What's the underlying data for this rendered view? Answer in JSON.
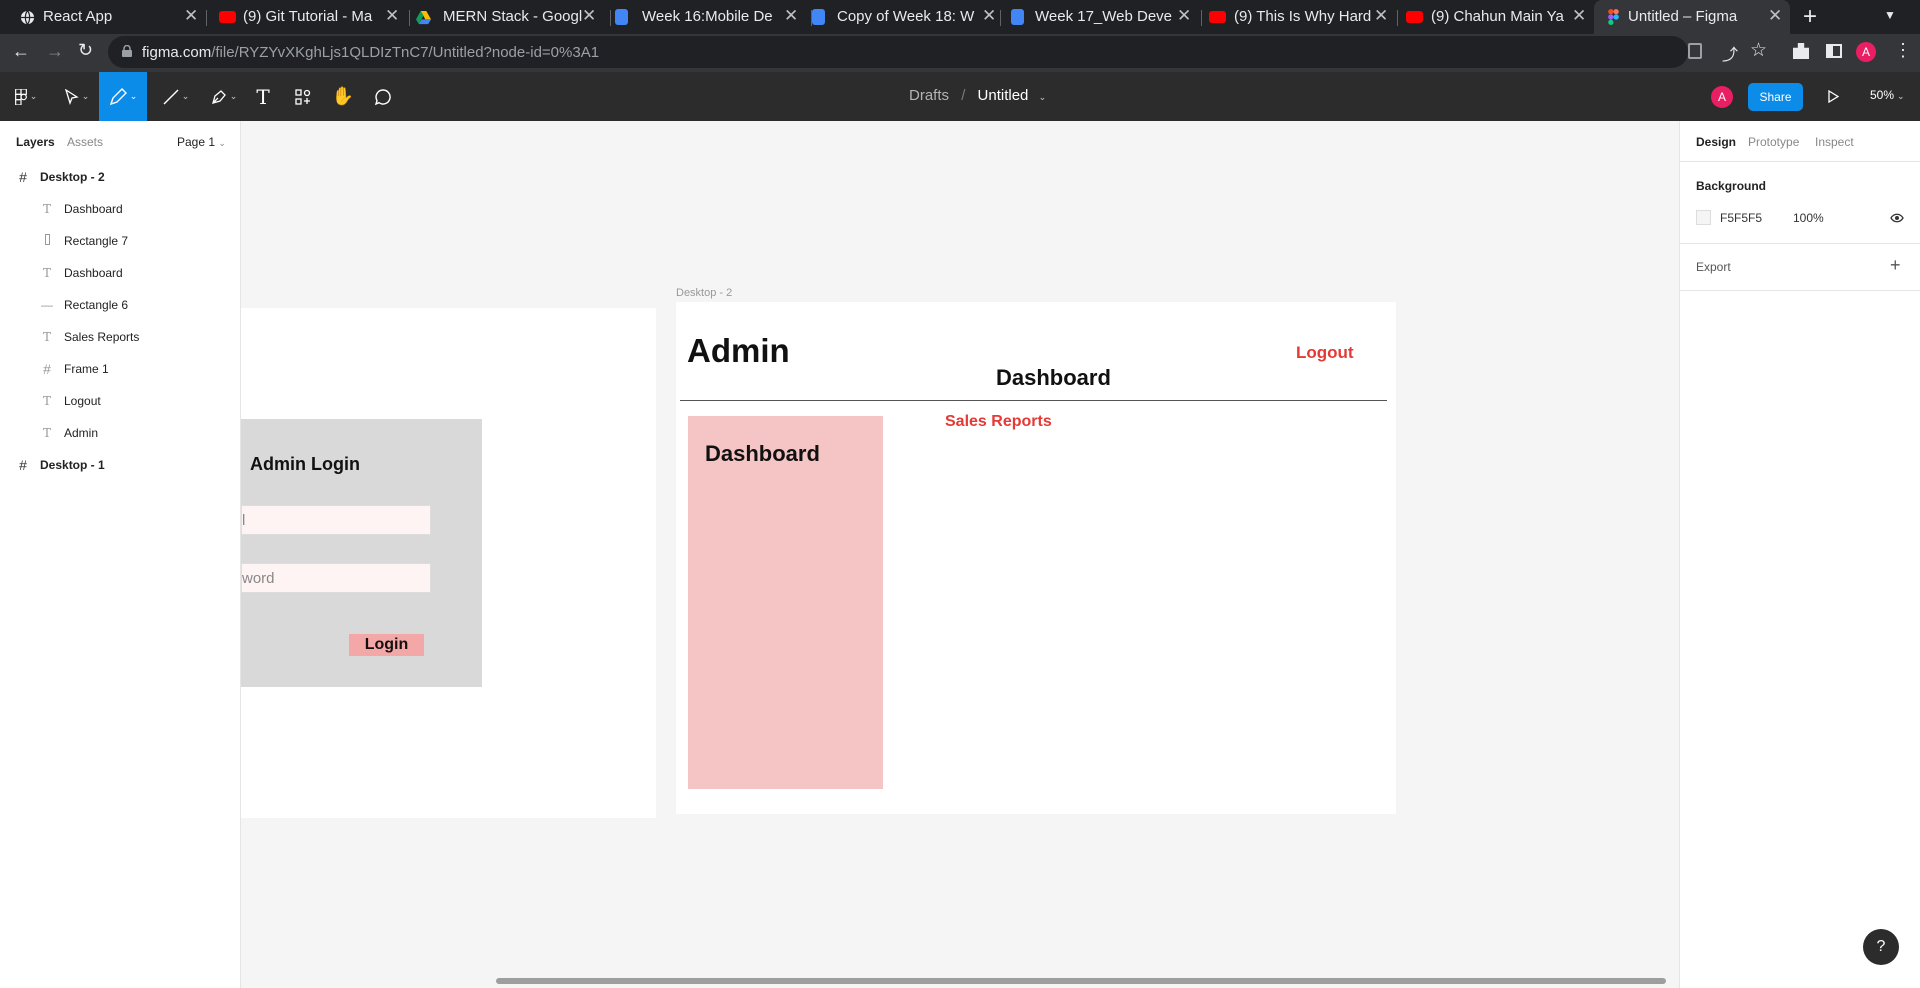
{
  "browser": {
    "tabs": [
      {
        "title": "React App",
        "icon": "globe-icon"
      },
      {
        "title": "(9) Git Tutorial - Ma",
        "icon": "youtube-icon"
      },
      {
        "title": "MERN Stack - Googl",
        "icon": "google-drive-icon"
      },
      {
        "title": "Week 16:Mobile De",
        "icon": "google-docs-icon"
      },
      {
        "title": "Copy of Week 18: W",
        "icon": "google-docs-icon"
      },
      {
        "title": "Week 17_Web Deve",
        "icon": "google-docs-icon"
      },
      {
        "title": "(9) This Is Why Hard",
        "icon": "youtube-icon"
      },
      {
        "title": "(9) Chahun Main Ya",
        "icon": "youtube-icon"
      },
      {
        "title": "Untitled – Figma",
        "icon": "figma-icon",
        "active": true
      }
    ],
    "new_tab": "+",
    "url_host": "figma.com",
    "url_path": "/file/RYZYvXKghLjs1QLDIzTnC7/Untitled?node-id=0%3A1",
    "profile_initial": "A"
  },
  "toolbar": {
    "breadcrumb_parent": "Drafts",
    "breadcrumb_sep": "/",
    "file_name": "Untitled",
    "avatar_initial": "A",
    "share_label": "Share",
    "zoom": "50%"
  },
  "left_panel": {
    "tab_layers": "Layers",
    "tab_assets": "Assets",
    "page": "Page 1",
    "layers": [
      {
        "name": "Desktop - 2",
        "type": "frame",
        "level": 0
      },
      {
        "name": "Dashboard",
        "type": "text",
        "level": 1
      },
      {
        "name": "Rectangle 7",
        "type": "rect",
        "level": 1
      },
      {
        "name": "Dashboard",
        "type": "text",
        "level": 1
      },
      {
        "name": "Rectangle 6",
        "type": "line",
        "level": 1
      },
      {
        "name": "Sales Reports",
        "type": "text",
        "level": 1
      },
      {
        "name": "Frame 1",
        "type": "frame",
        "level": 1
      },
      {
        "name": "Logout",
        "type": "text",
        "level": 1
      },
      {
        "name": "Admin",
        "type": "text",
        "level": 1
      },
      {
        "name": "Desktop - 1",
        "type": "frame",
        "level": 0
      }
    ]
  },
  "canvas": {
    "desktop1": {
      "login_title": "Admin Login",
      "email_placeholder": "l",
      "password_placeholder": "word",
      "login_button": "Login"
    },
    "desktop2": {
      "frame_label": "Desktop - 2",
      "admin": "Admin",
      "logout": "Logout",
      "dashboard_title": "Dashboard",
      "sales_reports": "Sales Reports",
      "sidebar_dashboard": "Dashboard"
    }
  },
  "right_panel": {
    "tab_design": "Design",
    "tab_prototype": "Prototype",
    "tab_inspect": "Inspect",
    "background_label": "Background",
    "bg_hex": "F5F5F5",
    "bg_opacity": "100%",
    "export_label": "Export",
    "export_add": "+"
  },
  "help_button": "?",
  "colors": {
    "accent": "#0c8ce9",
    "pink": "#f5c5c5",
    "red_text": "#e53935",
    "avatar": "#e91e63"
  }
}
